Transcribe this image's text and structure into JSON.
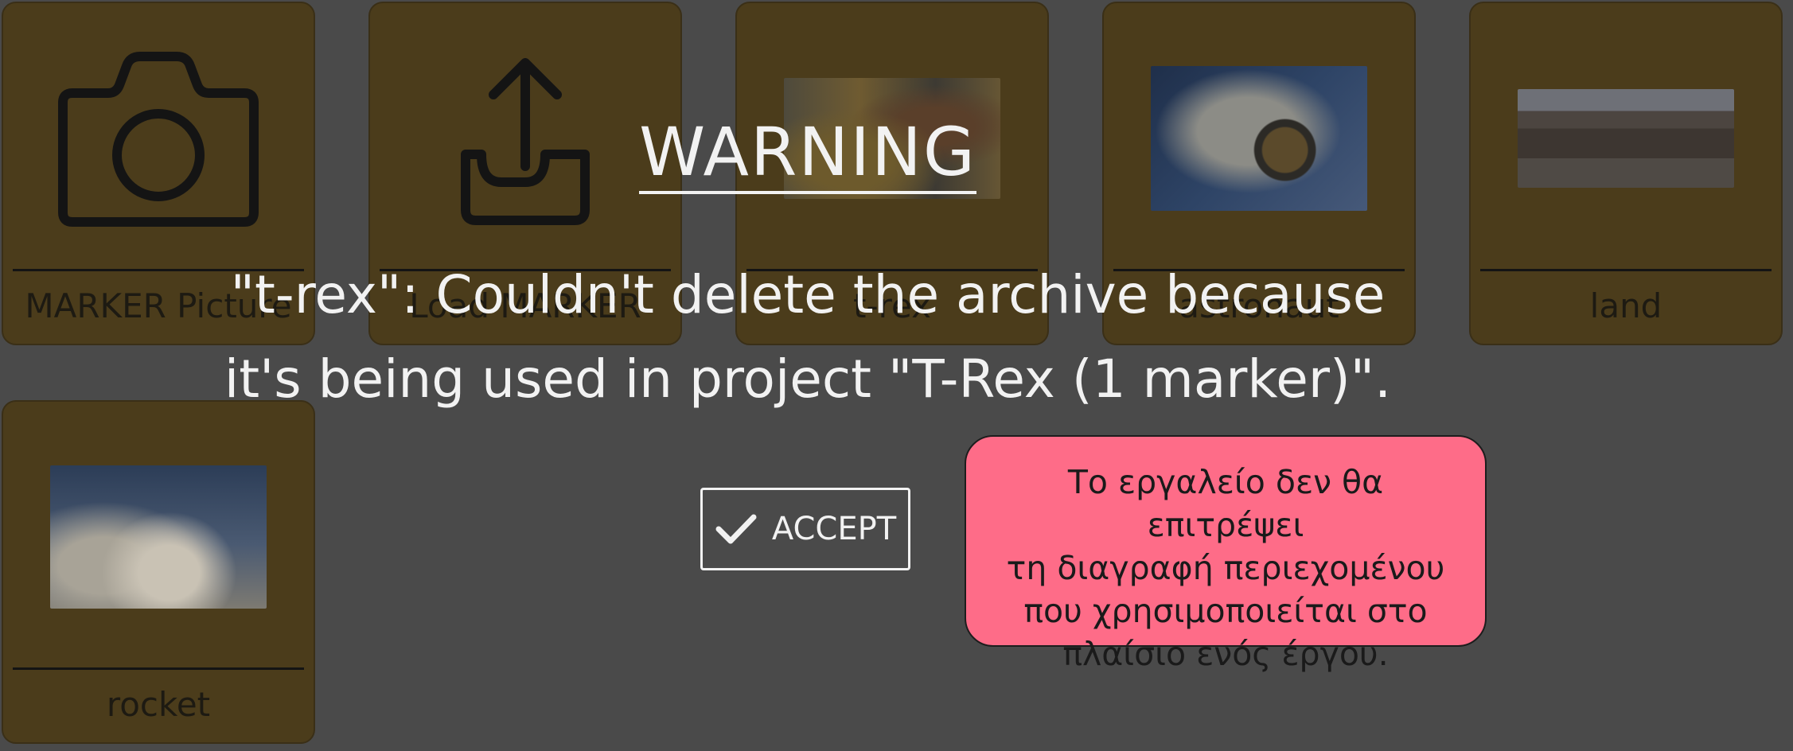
{
  "cards": [
    {
      "name": "MARKER Picture",
      "icon": "camera-icon"
    },
    {
      "name": "Load MARKER",
      "icon": "upload-icon"
    },
    {
      "name": "t-rex",
      "image": "t-rex-photo"
    },
    {
      "name": "astronaut",
      "image": "astronaut-photo"
    },
    {
      "name": "land",
      "image": "land-photo"
    },
    {
      "name": "rocket",
      "image": "rocket-photo"
    }
  ],
  "dialog": {
    "title": "WARNING",
    "message_line1": "\"t-rex\": Couldn't delete the archive because",
    "message_line2": "it's being used in project \"T-Rex (1 marker)\".",
    "accept_label": "ACCEPT"
  },
  "note": {
    "line1": "Το εργαλείο δεν θα επιτρέψει",
    "line2": "τη διαγραφή περιεχομένου",
    "line3": "που χρησιμοποιείται στο",
    "line4": "πλαίσιο ενός έργου.",
    "background": "#fe6c88"
  },
  "colors": {
    "overlay_bg": "#4a4a4a",
    "card_bg": "#4b3c1b",
    "dialog_text": "#f2f2f2"
  }
}
